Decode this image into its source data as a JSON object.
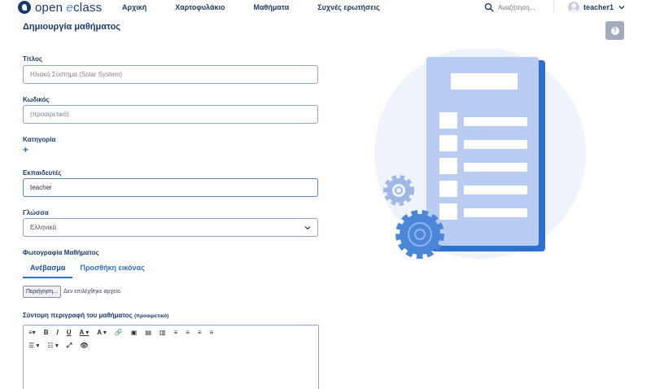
{
  "brand": {
    "name_prefix": "open",
    "name_mid": "e",
    "name_suffix": "class"
  },
  "nav": {
    "items": [
      "Αρχική",
      "Χαρτοφυλάκιο",
      "Μαθήματα",
      "Συχνές ερωτήσεις"
    ]
  },
  "search": {
    "placeholder": "Αναζήτηση..."
  },
  "user": {
    "name": "teacher1"
  },
  "page": {
    "title": "Δημιουργία μαθήματος",
    "help": "?"
  },
  "form": {
    "title": {
      "label": "Τίτλος",
      "placeholder": "Ηλιακό Σύστημα (Solar System)"
    },
    "code": {
      "label": "Κωδικός",
      "placeholder": "(προαιρετικό)"
    },
    "category": {
      "label": "Κατηγορία",
      "add": "+"
    },
    "instructors": {
      "label": "Εκπαιδευτές",
      "value": "teacher"
    },
    "language": {
      "label": "Γλώσσα",
      "value": "Ελληνικά"
    },
    "photo": {
      "label": "Φωτογραφία Μαθήματος",
      "tabs": [
        "Ανέβασμα",
        "Προσθήκη εικόνας"
      ],
      "browse_label": "Περιήγηση...",
      "no_file": "Δεν επιλέχθηκε αρχείο."
    },
    "description": {
      "label": "Σύντομη περιγραφή του μαθήματος",
      "optional": "(προαιρετικό)"
    }
  },
  "editor_toolbar": {
    "row1": [
      "≡▾",
      "B",
      "I",
      "U",
      "A ▾",
      "A ▾",
      "🔗",
      "▣",
      "▤",
      "▥",
      "≡",
      "≡",
      "≡",
      "≡"
    ],
    "row2": [
      "☰ ▾",
      "☷ ▾",
      "⤢",
      "👁"
    ]
  },
  "colors": {
    "primary": "#2f6fd0",
    "navy": "#1a3a6b",
    "border": "#8fa4c6"
  }
}
